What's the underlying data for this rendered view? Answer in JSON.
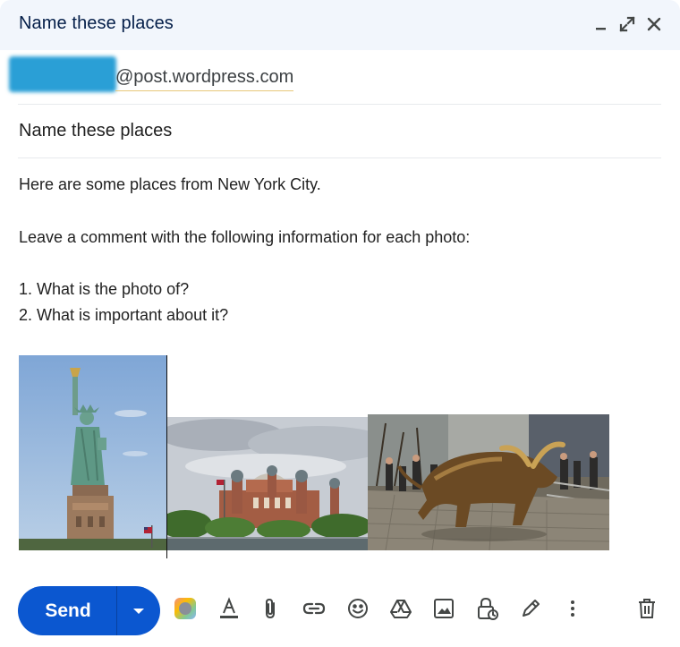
{
  "window": {
    "title": "Name these places"
  },
  "recipient": {
    "email_domain": "@post.wordpress.com"
  },
  "subject": "Name these places",
  "body": {
    "lines": [
      "Here are some places from New York City.",
      "Leave a comment with the following information for each photo:",
      "1. What is the photo of?",
      "2. What is important about it?"
    ]
  },
  "images": [
    {
      "name": "statue-of-liberty-photo"
    },
    {
      "name": "ellis-island-photo"
    },
    {
      "name": "charging-bull-photo"
    }
  ],
  "toolbar": {
    "send_label": "Send",
    "icons": [
      "send-options-icon",
      "ai-assist-icon",
      "formatting-icon",
      "attach-icon",
      "link-icon",
      "emoji-icon",
      "drive-icon",
      "photo-icon",
      "confidential-icon",
      "signature-icon",
      "more-options-icon",
      "discard-icon"
    ]
  },
  "colors": {
    "titlebar_bg": "#f2f6fc",
    "title_color": "#041e49",
    "send_bg": "#0b57d0",
    "redaction": "#2a9fd6"
  }
}
